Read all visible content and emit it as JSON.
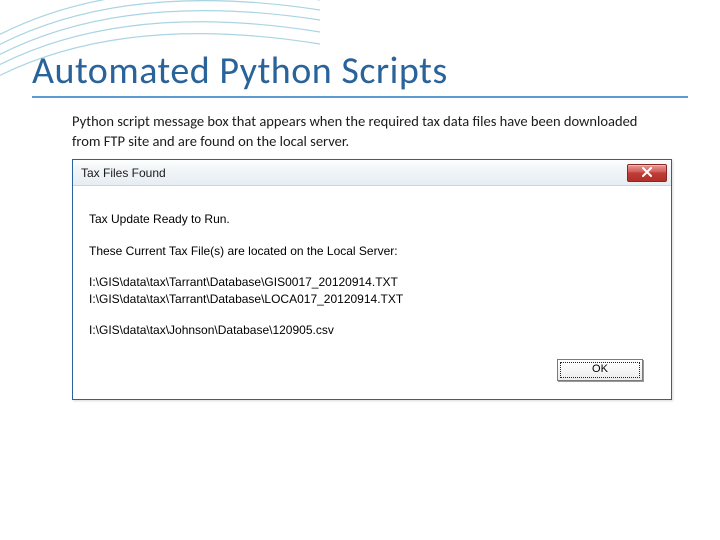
{
  "slide": {
    "title": "Automated Python Scripts",
    "description": "Python script message box that appears when the required tax data files have been downloaded from FTP site and are found on the local server."
  },
  "dialog": {
    "title": "Tax Files Found",
    "message_ready": "Tax Update Ready to Run.",
    "message_located": "These Current Tax File(s) are located on the Local Server:",
    "files_group1_a": "I:\\GIS\\data\\tax\\Tarrant\\Database\\GIS0017_20120914.TXT",
    "files_group1_b": "I:\\GIS\\data\\tax\\Tarrant\\Database\\LOCA017_20120914.TXT",
    "files_group2_a": "I:\\GIS\\data\\tax\\Johnson\\Database\\120905.csv",
    "ok_label": "OK"
  }
}
